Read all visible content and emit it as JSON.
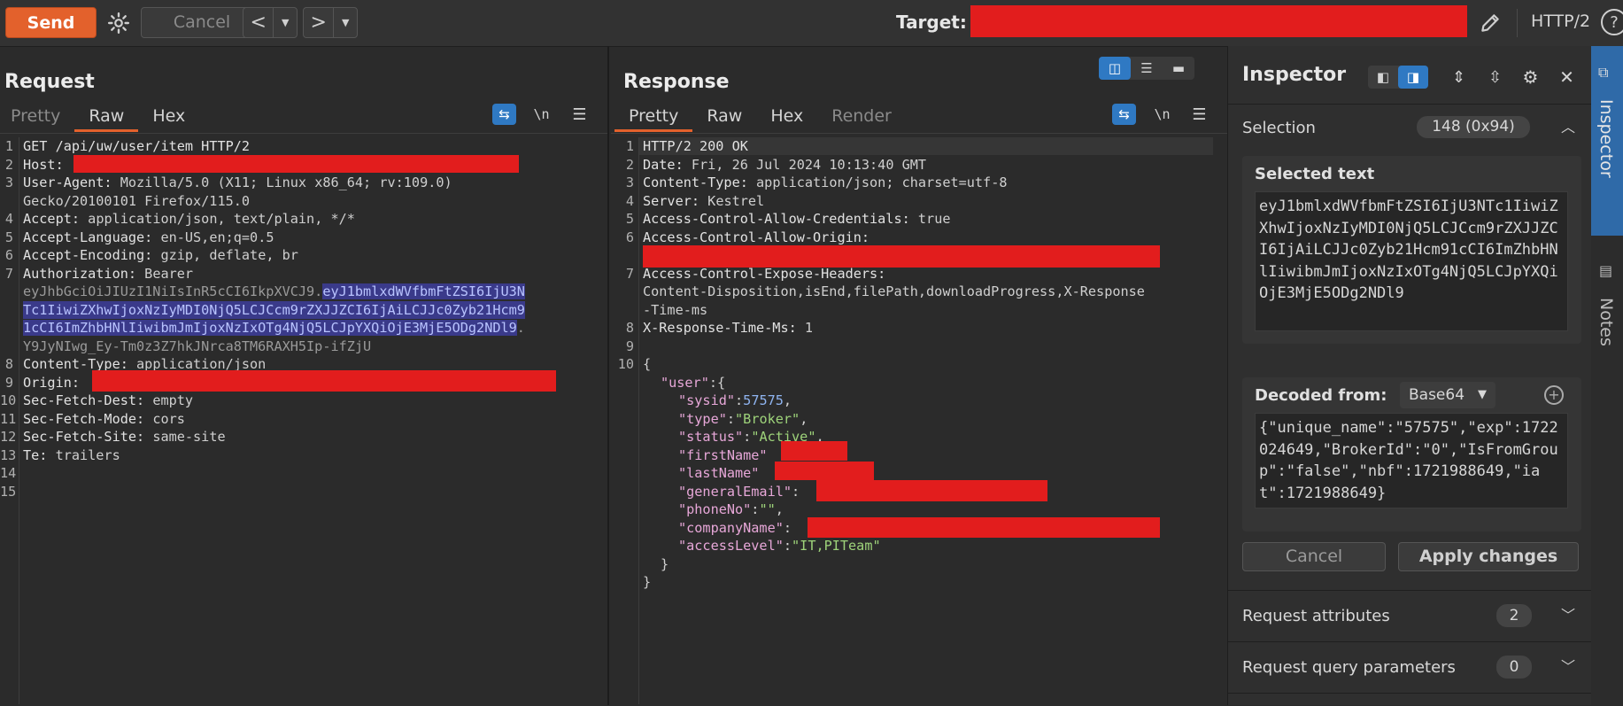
{
  "toolbar": {
    "send": "Send",
    "cancel": "Cancel",
    "target_label": "Target:",
    "protocol": "HTTP/2"
  },
  "request": {
    "title": "Request",
    "tabs": [
      "Pretty",
      "Raw",
      "Hex"
    ],
    "active_tab": "Raw",
    "line_numbers": [
      "1",
      "2",
      "3",
      "4",
      "5",
      "6",
      "7",
      "8",
      "9",
      "10",
      "11",
      "12",
      "13",
      "14",
      "15"
    ],
    "lines": {
      "l1": "GET /api/uw/user/item HTTP/2",
      "host_k": "Host:",
      "ua_k": "User-Agent:",
      "ua_v1": "Mozilla/5.0 (X11; Linux x86_64; rv:109.0)",
      "ua_v2": "Gecko/20100101 Firefox/115.0",
      "accept_k": "Accept:",
      "accept_v": "application/json, text/plain, */*",
      "lang_k": "Accept-Language:",
      "lang_v": "en-US,en;q=0.5",
      "enc_k": "Accept-Encoding:",
      "enc_v": "gzip, deflate, br",
      "auth_k": "Authorization:",
      "auth_v": "Bearer",
      "jwt_a": "eyJhbGciOiJIUzI1NiIsInR5cCI6IkpXVCJ9.",
      "jwt_sel1": "eyJ1bmlxdWVfbmFtZSI6IjU3N",
      "jwt_sel2": "Tc1IiwiZXhwIjoxNzIyMDI0NjQ5LCJCcm9rZXJJZCI6IjAiLCJJc0Zyb21Hcm9",
      "jwt_sel3": "1cCI6ImZhbHNlIiwibmJmIjoxNzIxOTg4NjQ5LCJpYXQiOjE3MjE5ODg2NDl9",
      "jwt_dot": ".",
      "jwt_c": "Y9JyNIwg_Ey-Tm0z3Z7hkJNrca8TM6RAXH5Ip-ifZjU",
      "ct_k": "Content-Type:",
      "ct_v": "application/json",
      "origin_k": "Origin:",
      "sfd_k": "Sec-Fetch-Dest:",
      "sfd_v": "empty",
      "sfm_k": "Sec-Fetch-Mode:",
      "sfm_v": "cors",
      "sfs_k": "Sec-Fetch-Site:",
      "sfs_v": "same-site",
      "te_k": "Te:",
      "te_v": "trailers"
    }
  },
  "response": {
    "title": "Response",
    "tabs": [
      "Pretty",
      "Raw",
      "Hex",
      "Render"
    ],
    "active_tab": "Pretty",
    "line_numbers": [
      "1",
      "2",
      "3",
      "4",
      "5",
      "6",
      "",
      "7",
      "",
      "",
      "8",
      "9",
      "10"
    ],
    "lines": {
      "l1": "HTTP/2 200 OK",
      "date_k": "Date:",
      "date_v": "Fri, 26 Jul 2024 10:13:40 GMT",
      "ct_k": "Content-Type:",
      "ct_v": "application/json; charset=utf-8",
      "srv_k": "Server:",
      "srv_v": "Kestrel",
      "acac_k": "Access-Control-Allow-Credentials:",
      "acac_v": "true",
      "acao_k": "Access-Control-Allow-Origin:",
      "aceh_k": "Access-Control-Expose-Headers:",
      "aceh_v1": "Content-Disposition,isEnd,filePath,downloadProgress,X-Response",
      "aceh_v2": "-Time-ms",
      "xrt_k": "X-Response-Time-Ms:",
      "xrt_v": "1",
      "brace_open": "{",
      "user_k": "\"user\"",
      "user_sep": ":{",
      "sysid_k": "\"sysid\"",
      "sysid_v": "57575",
      "type_k": "\"type\"",
      "type_v": "\"Broker\"",
      "status_k": "\"status\"",
      "status_v": "\"Active\"",
      "first_k": "\"firstName\"",
      "last_k": "\"lastName\"",
      "email_k": "\"generalEmail\"",
      "phone_k": "\"phoneNo\"",
      "phone_v": "\"\"",
      "company_k": "\"companyName\"",
      "access_k": "\"accessLevel\"",
      "access_v": "\"IT,PITeam\"",
      "inner_close": "}",
      "brace_close": "}"
    }
  },
  "inspector": {
    "title": "Inspector",
    "selection_label": "Selection",
    "selection_count": "148 (0x94)",
    "selected_text_label": "Selected text",
    "selected_text": "eyJ1bmlxdWVfbmFtZSI6IjU3NTc1IiwiZXhwIjoxNzIyMDI0NjQ5LCJCcm9rZXJJZCI6IjAiLCJJc0Zyb21Hcm91cCI6ImZhbHNlIiwibmJmIjoxNzIxOTg4NjQ5LCJpYXQiOjE3MjE5ODg2NDl9",
    "decoded_from_label": "Decoded from:",
    "decoder": "Base64",
    "decoded_text": "{\"unique_name\":\"57575\",\"exp\":1722024649,\"BrokerId\":\"0\",\"IsFromGroup\":\"false\",\"nbf\":1721988649,\"iat\":1721988649}",
    "cancel": "Cancel",
    "apply": "Apply changes",
    "sections": [
      {
        "label": "Request attributes",
        "count": "2"
      },
      {
        "label": "Request query parameters",
        "count": "0"
      }
    ]
  },
  "sidetabs": [
    "Inspector",
    "Notes"
  ],
  "colors": {
    "accent": "#e3612c",
    "selected_tab": "#2f79c3",
    "redaction": "#e21d1d"
  }
}
